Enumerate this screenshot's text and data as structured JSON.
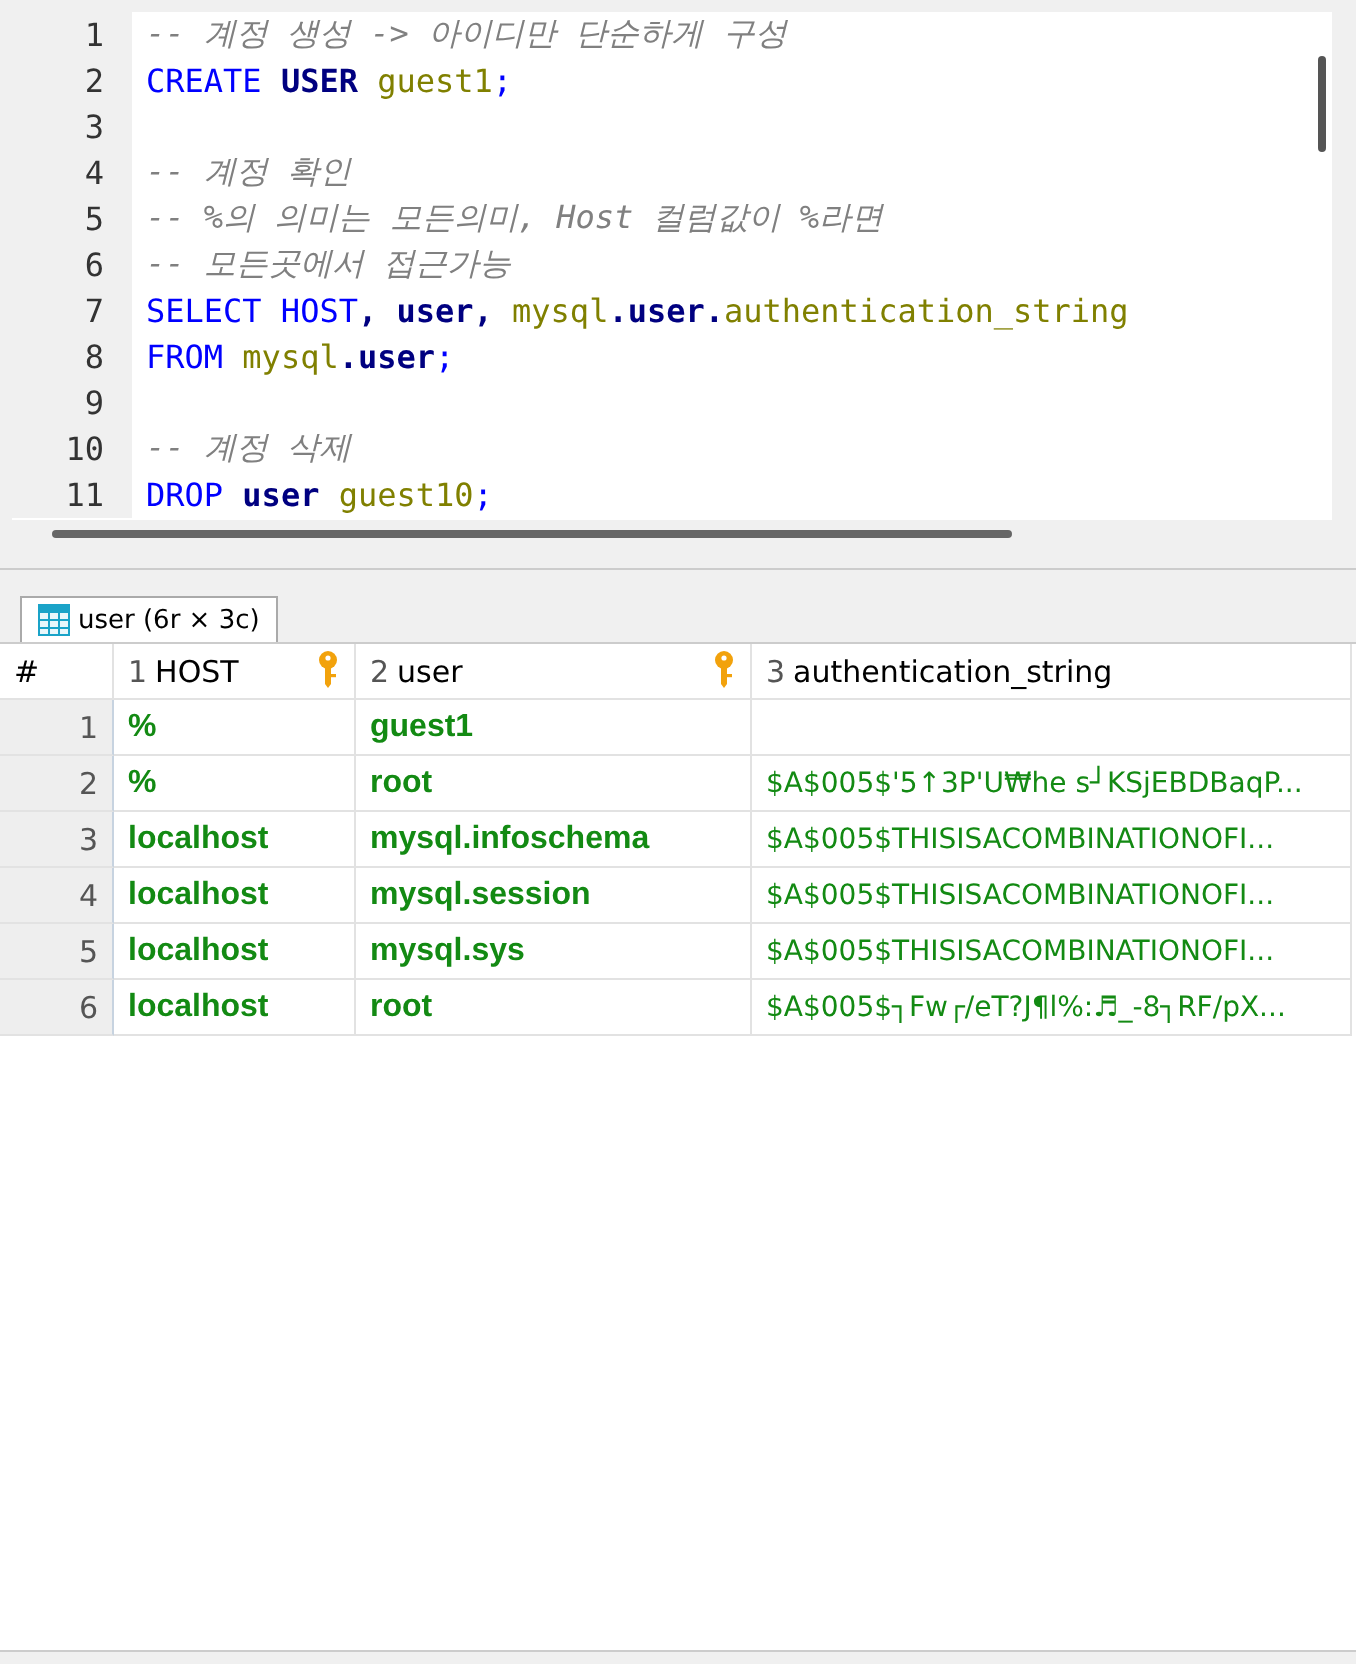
{
  "editor": {
    "lines": [
      {
        "number": "1",
        "tokens": [
          {
            "kind": "comment",
            "text": "-- 계정 생성 -> 아이디만 단순하게 구성"
          }
        ]
      },
      {
        "number": "2",
        "tokens": [
          {
            "kind": "keyword",
            "text": "CREATE "
          },
          {
            "kind": "name",
            "text": "USER "
          },
          {
            "kind": "ident",
            "text": "guest1"
          },
          {
            "kind": "punct",
            "text": ";"
          }
        ]
      },
      {
        "number": "3"
      },
      {
        "number": "4",
        "tokens": [
          {
            "kind": "comment",
            "text": "-- 계정 확인"
          }
        ]
      },
      {
        "number": "5",
        "tokens": [
          {
            "kind": "comment",
            "text": "-- %의 의미는 모든의미, Host 컬럼값이 %라면"
          }
        ]
      },
      {
        "number": "6",
        "tokens": [
          {
            "kind": "comment",
            "text": "-- 모든곳에서 접근가능"
          }
        ]
      },
      {
        "number": "7",
        "tokens": [
          {
            "kind": "keyword",
            "text": "SELECT HOST"
          },
          {
            "kind": "name",
            "text": ", user, "
          },
          {
            "kind": "ident",
            "text": "mysql"
          },
          {
            "kind": "name",
            "text": ".user."
          },
          {
            "kind": "ident",
            "text": "authentication_string"
          }
        ]
      },
      {
        "number": "8",
        "tokens": [
          {
            "kind": "keyword",
            "text": "FROM "
          },
          {
            "kind": "ident",
            "text": "mysql"
          },
          {
            "kind": "name",
            "text": ".user"
          },
          {
            "kind": "punct",
            "text": ";"
          }
        ]
      },
      {
        "number": "9"
      },
      {
        "number": "10",
        "tokens": [
          {
            "kind": "comment",
            "text": "-- 계정 삭제"
          }
        ]
      },
      {
        "number": "11",
        "tokens": [
          {
            "kind": "keyword",
            "text": "DROP "
          },
          {
            "kind": "name",
            "text": "user "
          },
          {
            "kind": "ident",
            "text": "guest10"
          },
          {
            "kind": "punct",
            "text": ";"
          }
        ]
      }
    ]
  },
  "result_tab": {
    "label": "user (6r × 3c)",
    "selected": true
  },
  "table": {
    "row_header": "#",
    "columns": [
      {
        "index": "1",
        "name": "HOST",
        "key": true
      },
      {
        "index": "2",
        "name": "user",
        "key": true
      },
      {
        "index": "3",
        "name": "authentication_string",
        "key": false
      }
    ],
    "rows": [
      {
        "number": "1",
        "cells": [
          "%",
          "guest1",
          ""
        ]
      },
      {
        "number": "2",
        "cells": [
          "%",
          "root",
          "$A$005$'5↑3P'U₩he s┘KSjEBDBaqP..."
        ]
      },
      {
        "number": "3",
        "cells": [
          "localhost",
          "mysql.infoschema",
          "$A$005$THISISACOMBINATIONOFI..."
        ]
      },
      {
        "number": "4",
        "cells": [
          "localhost",
          "mysql.session",
          "$A$005$THISISACOMBINATIONOFI..."
        ]
      },
      {
        "number": "5",
        "cells": [
          "localhost",
          "mysql.sys",
          "$A$005$THISISACOMBINATIONOFI..."
        ]
      },
      {
        "number": "6",
        "cells": [
          "localhost",
          "root",
          "$A$005$┐Fw┌/eT?J¶l%:♬_-8┐RF/pX..."
        ]
      }
    ]
  }
}
